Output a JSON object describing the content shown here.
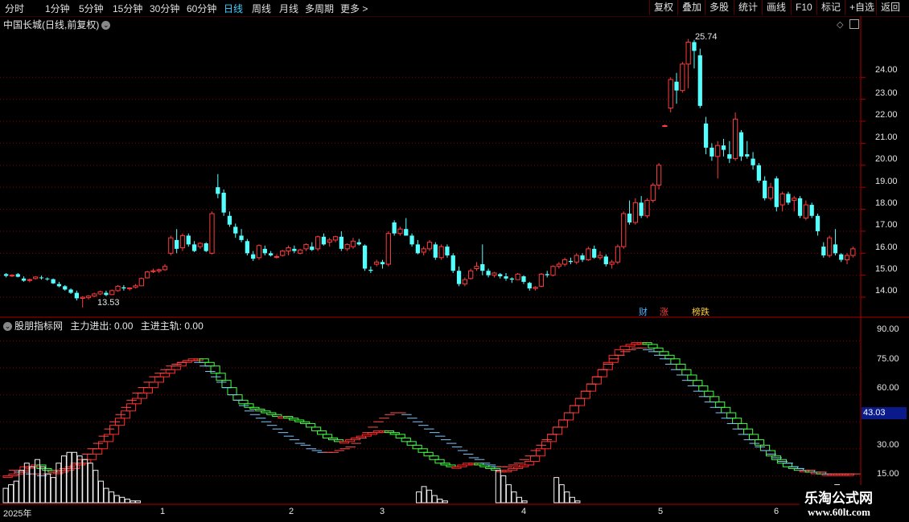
{
  "toolbar": {
    "periods": [
      "分时",
      "1分钟",
      "5分钟",
      "15分钟",
      "30分钟",
      "60分钟",
      "日线",
      "周线",
      "月线",
      "多周期",
      "更多 >"
    ],
    "active_period": "日线",
    "right_buttons": [
      "复权",
      "叠加",
      "多股",
      "统计",
      "画线",
      "F10",
      "标记",
      "+自选",
      "返回"
    ]
  },
  "main_chart": {
    "title": "中国长城(日线,前复权)",
    "high_label": "25.74",
    "low_label": "13.53",
    "y_ticks": [
      "24.00",
      "23.00",
      "22.00",
      "21.00",
      "20.00",
      "19.00",
      "18.00",
      "17.00",
      "16.00",
      "15.00",
      "14.00"
    ],
    "tags": [
      "财",
      "涨",
      "榜跌"
    ]
  },
  "indicator": {
    "title": "股朋指标网",
    "line1_label": "主力进出: 0.00",
    "line2_label": "主进主轨: 0.00",
    "y_ticks": [
      "90.00",
      "75.00",
      "60.00",
      "30.00",
      "15.00"
    ],
    "current_value": "43.03"
  },
  "date_axis": [
    "2025年",
    "1",
    "2",
    "3",
    "4",
    "5",
    "6"
  ],
  "watermark": {
    "line1": "乐淘公式网",
    "line2": "www.60lt.com"
  },
  "colors": {
    "up": "#ff3b3b",
    "down": "#54ffff",
    "grid": "#8a0000",
    "active": "#3fd0ff"
  },
  "chart_data": {
    "type": "candlestick",
    "ylim": [
      13.2,
      26.2
    ],
    "candles": [
      [
        15.05,
        15.1,
        14.9,
        14.97
      ],
      [
        15.0,
        15.05,
        14.92,
        15.0
      ],
      [
        15.05,
        15.1,
        14.9,
        14.93
      ],
      [
        14.85,
        14.95,
        14.7,
        14.75
      ],
      [
        14.78,
        14.85,
        14.68,
        14.8
      ],
      [
        14.85,
        14.95,
        14.8,
        14.92
      ],
      [
        14.9,
        14.98,
        14.8,
        14.88
      ],
      [
        14.85,
        14.9,
        14.75,
        14.82
      ],
      [
        14.82,
        14.85,
        14.6,
        14.63
      ],
      [
        14.6,
        14.7,
        14.45,
        14.5
      ],
      [
        14.5,
        14.55,
        14.3,
        14.35
      ],
      [
        14.35,
        14.4,
        14.15,
        14.2
      ],
      [
        14.2,
        14.3,
        13.85,
        13.95
      ],
      [
        13.95,
        14.05,
        13.53,
        14.0
      ],
      [
        13.98,
        14.1,
        13.9,
        14.05
      ],
      [
        14.05,
        14.2,
        14.0,
        14.15
      ],
      [
        14.15,
        14.3,
        14.1,
        14.25
      ],
      [
        14.2,
        14.3,
        14.05,
        14.1
      ],
      [
        14.12,
        14.35,
        14.1,
        14.3
      ],
      [
        14.3,
        14.55,
        14.25,
        14.5
      ],
      [
        14.45,
        14.55,
        14.3,
        14.4
      ],
      [
        14.38,
        14.45,
        14.3,
        14.42
      ],
      [
        14.45,
        14.6,
        14.4,
        14.52
      ],
      [
        14.52,
        14.9,
        14.5,
        14.85
      ],
      [
        14.88,
        15.2,
        14.85,
        15.15
      ],
      [
        15.18,
        15.3,
        15.1,
        15.2
      ],
      [
        15.2,
        15.3,
        15.1,
        15.25
      ],
      [
        15.25,
        15.5,
        15.2,
        15.4
      ],
      [
        16.0,
        16.8,
        15.9,
        16.7
      ],
      [
        16.6,
        17.1,
        16.0,
        16.2
      ],
      [
        16.25,
        16.9,
        16.1,
        16.8
      ],
      [
        16.8,
        16.9,
        16.3,
        16.4
      ],
      [
        16.4,
        16.55,
        16.05,
        16.1
      ],
      [
        16.3,
        16.5,
        16.2,
        16.45
      ],
      [
        16.45,
        16.5,
        16.05,
        16.1
      ],
      [
        16.0,
        17.9,
        15.95,
        17.8
      ],
      [
        19.0,
        19.6,
        18.5,
        18.7
      ],
      [
        18.75,
        18.9,
        17.7,
        17.85
      ],
      [
        17.7,
        17.9,
        17.2,
        17.3
      ],
      [
        17.2,
        17.35,
        16.7,
        16.9
      ],
      [
        16.8,
        17.1,
        16.5,
        16.6
      ],
      [
        16.55,
        16.65,
        15.9,
        16.0
      ],
      [
        15.95,
        16.1,
        15.65,
        15.75
      ],
      [
        15.8,
        16.4,
        15.7,
        16.35
      ],
      [
        16.2,
        16.35,
        15.9,
        16.0
      ],
      [
        16.0,
        16.1,
        15.85,
        15.9
      ],
      [
        15.85,
        15.95,
        15.75,
        15.85
      ],
      [
        15.9,
        16.15,
        15.85,
        16.1
      ],
      [
        16.1,
        16.35,
        15.9,
        16.25
      ],
      [
        16.2,
        16.35,
        16.0,
        16.1
      ],
      [
        16.0,
        16.2,
        15.95,
        16.15
      ],
      [
        16.2,
        16.45,
        16.1,
        16.4
      ],
      [
        16.3,
        16.5,
        16.1,
        16.15
      ],
      [
        16.2,
        16.8,
        16.1,
        16.75
      ],
      [
        16.75,
        16.9,
        16.35,
        16.4
      ],
      [
        16.5,
        16.7,
        16.3,
        16.6
      ],
      [
        16.6,
        16.8,
        16.5,
        16.75
      ],
      [
        16.75,
        17.0,
        16.1,
        16.2
      ],
      [
        16.2,
        16.45,
        16.1,
        16.4
      ],
      [
        16.3,
        16.7,
        16.2,
        16.55
      ],
      [
        16.5,
        16.65,
        16.35,
        16.4
      ],
      [
        16.35,
        16.4,
        15.2,
        15.3
      ],
      [
        15.25,
        15.4,
        15.1,
        15.2
      ],
      [
        15.5,
        15.7,
        15.4,
        15.6
      ],
      [
        15.6,
        15.7,
        15.3,
        15.5
      ],
      [
        15.5,
        17.0,
        15.4,
        16.9
      ],
      [
        17.4,
        17.5,
        16.8,
        16.9
      ],
      [
        16.9,
        17.2,
        16.8,
        17.1
      ],
      [
        17.1,
        17.6,
        16.8,
        16.8
      ],
      [
        16.8,
        16.9,
        16.3,
        16.4
      ],
      [
        16.4,
        16.6,
        15.95,
        16.0
      ],
      [
        16.05,
        16.3,
        15.9,
        16.2
      ],
      [
        16.2,
        16.6,
        16.1,
        16.5
      ],
      [
        16.4,
        16.5,
        15.7,
        15.8
      ],
      [
        15.8,
        16.4,
        15.7,
        16.3
      ],
      [
        16.3,
        16.4,
        15.8,
        15.9
      ],
      [
        15.9,
        16.0,
        15.1,
        15.2
      ],
      [
        15.2,
        15.4,
        14.5,
        14.6
      ],
      [
        14.6,
        14.9,
        14.5,
        14.8
      ],
      [
        14.85,
        15.3,
        14.8,
        15.2
      ],
      [
        15.3,
        15.6,
        15.2,
        15.4
      ],
      [
        15.5,
        16.4,
        15.0,
        15.2
      ],
      [
        15.2,
        15.3,
        14.9,
        15.0
      ],
      [
        15.0,
        15.15,
        14.9,
        15.1
      ],
      [
        15.05,
        15.1,
        14.85,
        14.95
      ],
      [
        14.95,
        15.1,
        14.75,
        14.85
      ],
      [
        14.85,
        14.9,
        14.65,
        14.8
      ],
      [
        14.8,
        15.1,
        14.8,
        15.05
      ],
      [
        14.95,
        15.0,
        14.6,
        14.7
      ],
      [
        14.65,
        14.7,
        14.3,
        14.4
      ],
      [
        14.4,
        14.5,
        14.3,
        14.45
      ],
      [
        14.5,
        15.1,
        14.45,
        15.05
      ],
      [
        15.05,
        15.2,
        14.9,
        15.0
      ],
      [
        15.0,
        15.45,
        14.95,
        15.4
      ],
      [
        15.4,
        15.6,
        15.3,
        15.5
      ],
      [
        15.5,
        15.8,
        15.4,
        15.7
      ],
      [
        15.65,
        15.8,
        15.5,
        15.6
      ],
      [
        15.6,
        16.0,
        15.5,
        15.9
      ],
      [
        15.9,
        16.0,
        15.6,
        15.7
      ],
      [
        15.7,
        16.3,
        15.65,
        16.2
      ],
      [
        16.2,
        16.35,
        15.75,
        15.8
      ],
      [
        15.8,
        16.1,
        15.7,
        15.9
      ],
      [
        15.85,
        15.95,
        15.4,
        15.5
      ],
      [
        15.5,
        15.7,
        15.3,
        15.6
      ],
      [
        15.6,
        16.4,
        15.5,
        16.3
      ],
      [
        16.3,
        17.9,
        16.2,
        17.8
      ],
      [
        17.8,
        18.4,
        17.3,
        17.4
      ],
      [
        17.4,
        18.5,
        17.3,
        18.3
      ],
      [
        18.3,
        18.6,
        17.6,
        17.7
      ],
      [
        17.7,
        18.5,
        17.6,
        18.4
      ],
      [
        18.4,
        19.2,
        18.3,
        19.1
      ],
      [
        19.1,
        20.1,
        18.9,
        20.0
      ],
      [
        21.8,
        21.85,
        21.75,
        21.8
      ],
      [
        22.6,
        24.0,
        22.4,
        23.9
      ],
      [
        23.8,
        24.2,
        22.8,
        23.4
      ],
      [
        23.4,
        24.7,
        23.3,
        24.6
      ],
      [
        24.6,
        25.74,
        23.5,
        25.6
      ],
      [
        25.6,
        25.7,
        24.4,
        25.2
      ],
      [
        25.0,
        25.3,
        22.6,
        22.7
      ],
      [
        21.9,
        22.2,
        20.5,
        20.8
      ],
      [
        20.8,
        21.0,
        20.2,
        20.4
      ],
      [
        20.4,
        21.1,
        19.4,
        20.9
      ],
      [
        20.9,
        21.2,
        20.4,
        20.7
      ],
      [
        20.5,
        21.1,
        20.1,
        20.3
      ],
      [
        20.3,
        22.4,
        20.2,
        22.1
      ],
      [
        21.5,
        21.6,
        20.2,
        20.4
      ],
      [
        20.5,
        21.1,
        20.3,
        20.4
      ],
      [
        20.3,
        20.6,
        19.8,
        20.0
      ],
      [
        20.0,
        20.1,
        19.2,
        19.3
      ],
      [
        19.3,
        19.5,
        18.4,
        18.5
      ],
      [
        18.5,
        19.2,
        18.4,
        19.0
      ],
      [
        19.4,
        19.5,
        17.9,
        18.1
      ],
      [
        18.2,
        18.8,
        17.9,
        18.7
      ],
      [
        18.7,
        18.8,
        18.2,
        18.3
      ],
      [
        18.4,
        18.6,
        17.9,
        18.5
      ],
      [
        18.5,
        18.6,
        17.6,
        17.7
      ],
      [
        17.6,
        18.4,
        17.5,
        18.2
      ],
      [
        18.2,
        18.3,
        17.6,
        17.7
      ],
      [
        17.7,
        17.8,
        16.8,
        17.0
      ],
      [
        16.3,
        16.5,
        15.8,
        15.9
      ],
      [
        15.9,
        16.8,
        15.8,
        16.7
      ],
      [
        16.4,
        17.1,
        15.9,
        16.0
      ],
      [
        15.95,
        16.0,
        15.6,
        15.7
      ],
      [
        15.7,
        16.0,
        15.5,
        15.9
      ],
      [
        15.9,
        16.3,
        15.8,
        16.2
      ]
    ],
    "indicator": {
      "ylim": [
        0,
        100
      ],
      "red_line": [
        15,
        15,
        16,
        18,
        20,
        20,
        21,
        19,
        18,
        17,
        17,
        18,
        19,
        21,
        22,
        24,
        27,
        30,
        34,
        38,
        43,
        47,
        51,
        55,
        58,
        61,
        64,
        67,
        70,
        72,
        74,
        76,
        78,
        79,
        80,
        80,
        78,
        76,
        72,
        68,
        64,
        60,
        57,
        55,
        53,
        52,
        51,
        50,
        49,
        48,
        48,
        47,
        46,
        45,
        44,
        42,
        40,
        38,
        36,
        35,
        34,
        34,
        35,
        36,
        37,
        38,
        39,
        40,
        40,
        39,
        38,
        36,
        34,
        32,
        30,
        28,
        26,
        24,
        22,
        21,
        20,
        20,
        21,
        22,
        22,
        21,
        20,
        19,
        18,
        18,
        18,
        19,
        20,
        21,
        23,
        26,
        30,
        34,
        38,
        42,
        46,
        50,
        54,
        58,
        62,
        66,
        70,
        74,
        78,
        82,
        85,
        87,
        88,
        89,
        89,
        88,
        86,
        84,
        82,
        80,
        77,
        74,
        71,
        68,
        65,
        62,
        59,
        56,
        53,
        50,
        47,
        44,
        41,
        38,
        35,
        32,
        29,
        26,
        24,
        22,
        20,
        19,
        18,
        18,
        17,
        17,
        16,
        16,
        16,
        16,
        16,
        16
      ],
      "blue_line": [
        18,
        18,
        17,
        17,
        16,
        16,
        15,
        16,
        17,
        18,
        19,
        20,
        22,
        24,
        27,
        30,
        33,
        37,
        41,
        45,
        49,
        53,
        57,
        61,
        64,
        67,
        70,
        72,
        74,
        76,
        77,
        78,
        79,
        79,
        78,
        76,
        73,
        70,
        67,
        64,
        60,
        57,
        54,
        51,
        49,
        47,
        45,
        43,
        41,
        39,
        37,
        35,
        33,
        32,
        30,
        29,
        28,
        28,
        28,
        29,
        30,
        31,
        33,
        36,
        39,
        42,
        45,
        47,
        49,
        50,
        50,
        49,
        47,
        45,
        43,
        41,
        39,
        37,
        35,
        33,
        31,
        29,
        27,
        25,
        24,
        22,
        21,
        20,
        20,
        20,
        21,
        22,
        24,
        26,
        29,
        32,
        35,
        38,
        42,
        46,
        50,
        54,
        58,
        62,
        66,
        70,
        74,
        77,
        80,
        82,
        84,
        85,
        86,
        86,
        85,
        84,
        82,
        80,
        77,
        74,
        71,
        68,
        65,
        62,
        59,
        56,
        53,
        50,
        47,
        44,
        41,
        38,
        35,
        33,
        31,
        29,
        27,
        25,
        23,
        22,
        20,
        19,
        18,
        18,
        17,
        17,
        16,
        16,
        16,
        16,
        16,
        16
      ],
      "volume": [
        8,
        10,
        12,
        18,
        22,
        20,
        24,
        20,
        16,
        14,
        22,
        26,
        28,
        28,
        26,
        24,
        22,
        18,
        12,
        8,
        6,
        4,
        3,
        2,
        1,
        1,
        0,
        0,
        0,
        0,
        0,
        0,
        0,
        0,
        0,
        0,
        0,
        0,
        0,
        0,
        0,
        0,
        0,
        0,
        0,
        0,
        0,
        0,
        0,
        0,
        0,
        0,
        0,
        0,
        0,
        0,
        0,
        0,
        0,
        0,
        0,
        0,
        0,
        0,
        0,
        0,
        0,
        0,
        0,
        0,
        0,
        0,
        0,
        0,
        0,
        0,
        0,
        0,
        6,
        9,
        7,
        4,
        2,
        1,
        0,
        0,
        0,
        0,
        0,
        0,
        0,
        0,
        0,
        18,
        15,
        10,
        6,
        3,
        1,
        0,
        0,
        0,
        0,
        0,
        14,
        10,
        6,
        3,
        1,
        0,
        0,
        0,
        0,
        0,
        0,
        0,
        0,
        0,
        0,
        0,
        0,
        0,
        0,
        0,
        0,
        0,
        0,
        0,
        0,
        0,
        0,
        0,
        0,
        0,
        0,
        0,
        0,
        0,
        0,
        0,
        0,
        0,
        0,
        0,
        0,
        0,
        0,
        0,
        0,
        0,
        0,
        0,
        0,
        0,
        3,
        6,
        9,
        10,
        6,
        3,
        1
      ]
    }
  }
}
